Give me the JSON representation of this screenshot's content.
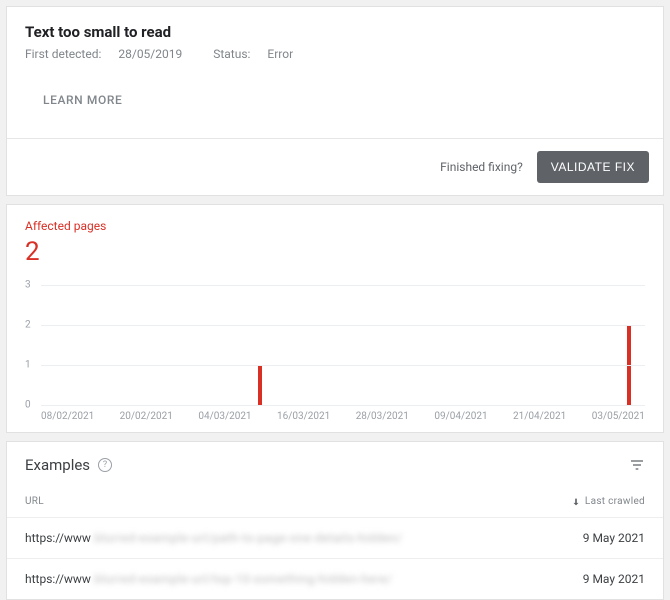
{
  "header": {
    "title": "Text too small to read",
    "meta_detected_label": "First detected:",
    "meta_detected_value": "28/05/2019",
    "meta_status_label": "Status:",
    "meta_status_value": "Error",
    "learn_more": "LEARN MORE",
    "finished_fixing": "Finished fixing?",
    "validate_fix": "VALIDATE FIX"
  },
  "affected": {
    "label": "Affected pages",
    "count": "2"
  },
  "chart_data": {
    "type": "bar",
    "categories": [
      "08/02/2021",
      "20/02/2021",
      "04/03/2021",
      "16/03/2021",
      "28/03/2021",
      "09/04/2021",
      "21/04/2021",
      "03/05/2021"
    ],
    "y_ticks": [
      "3",
      "2",
      "1",
      "0"
    ],
    "ylim": [
      0,
      3
    ],
    "bars": [
      {
        "x_pct": 36,
        "value": 1
      },
      {
        "x_pct": 97,
        "value": 2
      }
    ]
  },
  "examples": {
    "title": "Examples",
    "col_url": "URL",
    "col_crawled": "Last crawled",
    "rows": [
      {
        "prefix": "https://www",
        "blurred": ".blurred-example-url/path-to-page-one-details-hidden/",
        "crawled": "9 May 2021"
      },
      {
        "prefix": "https://www",
        "blurred": ".blurred-example-url/top-10-something-hidden-here/",
        "crawled": "9 May 2021"
      }
    ]
  }
}
